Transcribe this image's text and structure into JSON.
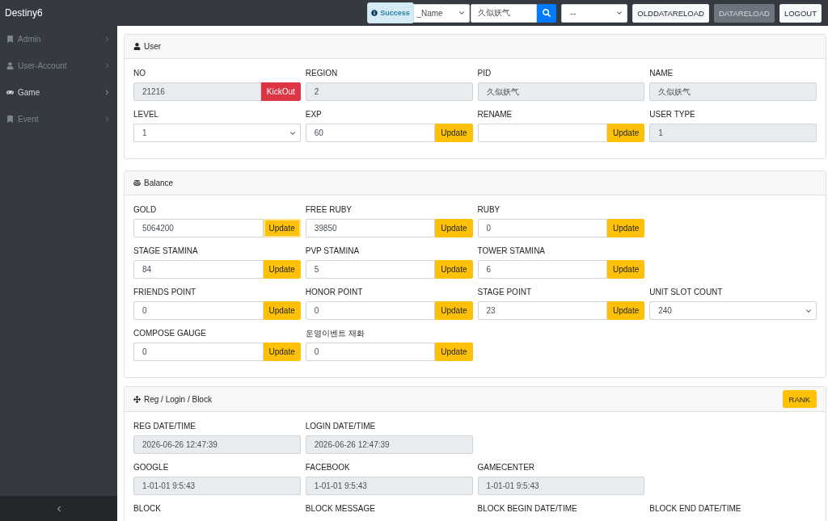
{
  "topbar": {
    "brand": "Destiny6",
    "toast": {
      "text": "Success"
    },
    "search_type": {
      "value": "_Name"
    },
    "search_field": {
      "value": "久似妖气"
    },
    "filter": {
      "value": "--"
    },
    "buttons": [
      {
        "label": "OLDDATARELOAD",
        "disabled": false
      },
      {
        "label": "DATARELOAD",
        "disabled": true
      },
      {
        "label": "LOGOUT",
        "disabled": false
      }
    ]
  },
  "sidebar": {
    "items": [
      {
        "label": "Admin",
        "selected": false
      },
      {
        "label": "User-Account",
        "selected": false
      },
      {
        "label": "Game",
        "selected": true
      },
      {
        "label": "Event",
        "selected": false
      }
    ]
  },
  "panels": [
    {
      "title": "User",
      "rows": [
        [
          {
            "label": "NO",
            "kind": "readonly",
            "value": "21216",
            "button": {
              "label": "KickOut",
              "kind": "danger",
              "focused": false
            }
          },
          {
            "label": "REGION",
            "kind": "readonly",
            "value": "2"
          },
          {
            "label": "PID",
            "kind": "readonly",
            "value": "久似妖气"
          },
          {
            "label": "NAME",
            "kind": "readonly",
            "value": "久似妖气"
          }
        ],
        [
          {
            "label": "LEVEL",
            "kind": "select",
            "value": "1"
          },
          {
            "label": "EXP",
            "kind": "input",
            "value": "60",
            "button": {
              "label": "Update",
              "kind": "warning",
              "focused": false
            }
          },
          {
            "label": "RENAME",
            "kind": "input",
            "button": {
              "label": "Update",
              "kind": "warning",
              "focused": false
            }
          },
          {
            "label": "USER TYPE",
            "kind": "readonly",
            "value": "1"
          }
        ]
      ]
    },
    {
      "title": "Balance",
      "rows": [
        [
          {
            "label": "GOLD",
            "kind": "input",
            "value": "5064200",
            "button": {
              "label": "Update",
              "kind": "warning",
              "focused": true
            }
          },
          {
            "label": "FREE RUBY",
            "kind": "input",
            "value": "39850",
            "button": {
              "label": "Update",
              "kind": "warning",
              "focused": false
            }
          },
          {
            "label": "RUBY",
            "kind": "input",
            "value": "0",
            "button": {
              "label": "Update",
              "kind": "warning",
              "focused": false
            }
          }
        ],
        [
          {
            "label": "STAGE STAMINA",
            "kind": "input",
            "value": "84",
            "button": {
              "label": "Update",
              "kind": "warning",
              "focused": false
            }
          },
          {
            "label": "PVP STAMINA",
            "kind": "input",
            "value": "5",
            "button": {
              "label": "Update",
              "kind": "warning",
              "focused": false
            }
          },
          {
            "label": "TOWER STAMINA",
            "kind": "input",
            "value": "6",
            "button": {
              "label": "Update",
              "kind": "warning",
              "focused": false
            }
          }
        ],
        [
          {
            "label": "FRIENDS POINT",
            "kind": "input",
            "value": "0",
            "button": {
              "label": "Update",
              "kind": "warning",
              "focused": false
            }
          },
          {
            "label": "HONOR POINT",
            "kind": "input",
            "value": "0",
            "button": {
              "label": "Update",
              "kind": "warning",
              "focused": false
            }
          },
          {
            "label": "STAGE POINT",
            "kind": "input",
            "value": "23",
            "button": {
              "label": "Update",
              "kind": "warning",
              "focused": false
            }
          },
          {
            "label": "UNIT SLOT COUNT",
            "kind": "select",
            "value": "240"
          }
        ],
        [
          {
            "label": "COMPOSE GAUGE",
            "kind": "input",
            "value": "0",
            "button": {
              "label": "Update",
              "kind": "warning",
              "focused": false
            }
          },
          {
            "label": "운영이벤트 재화",
            "kind": "input",
            "value": "0",
            "button": {
              "label": "Update",
              "kind": "warning",
              "focused": false
            }
          }
        ]
      ]
    },
    {
      "title": "Reg / Login / Block",
      "header_button": {
        "label": "RANK"
      },
      "rows": [
        [
          {
            "label": "REG DATE/TIME",
            "kind": "readonly",
            "value": "2026-06-26 12:47:39"
          },
          {
            "label": "LOGIN DATE/TIME",
            "kind": "readonly",
            "value": "2026-06-26 12:47:39"
          }
        ],
        [
          {
            "label": "GOOGLE",
            "kind": "readonly",
            "value": "1-01-01 9:5:43"
          },
          {
            "label": "FACEBOOK",
            "kind": "readonly",
            "value": "1-01-01 9:5:43"
          },
          {
            "label": "GAMECENTER",
            "kind": "readonly",
            "value": "1-01-01 9:5:43"
          }
        ],
        [
          {
            "label": "BLOCK"
          },
          {
            "label": "BLOCK MESSAGE"
          },
          {
            "label": "BLOCK BEGIN DATE/TIME"
          },
          {
            "label": "BLOCK END DATE/TIME"
          }
        ]
      ]
    }
  ]
}
